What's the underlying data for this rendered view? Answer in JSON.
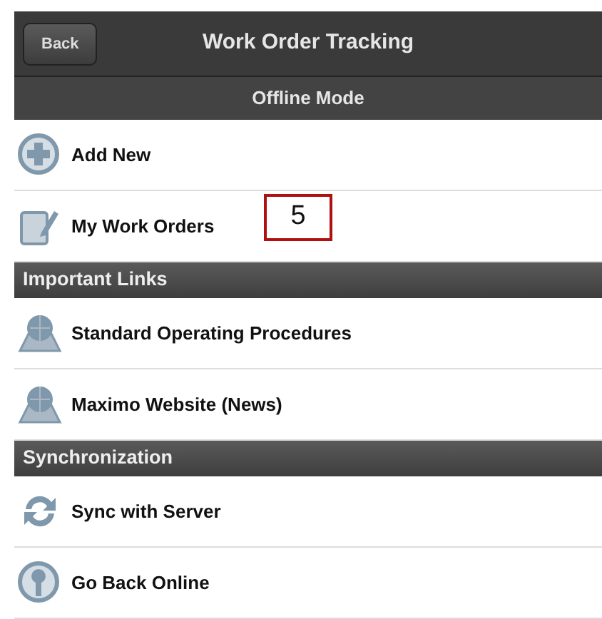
{
  "header": {
    "back_button": "Back",
    "title": "Work Order Tracking",
    "subtitle": "Offline Mode"
  },
  "sections": [
    {
      "items": [
        {
          "label": "Add New",
          "kind": "add"
        },
        {
          "label": "My Work Orders",
          "kind": "clipboard",
          "annotation": "5"
        }
      ]
    },
    {
      "title": "Important Links",
      "items": [
        {
          "label": "Standard Operating Procedures",
          "kind": "globe"
        },
        {
          "label": "Maximo Website (News)",
          "kind": "globe"
        }
      ]
    },
    {
      "title": "Synchronization",
      "items": [
        {
          "label": "Sync with Server",
          "kind": "sync"
        },
        {
          "label": "Go Back Online",
          "kind": "online"
        }
      ]
    }
  ]
}
